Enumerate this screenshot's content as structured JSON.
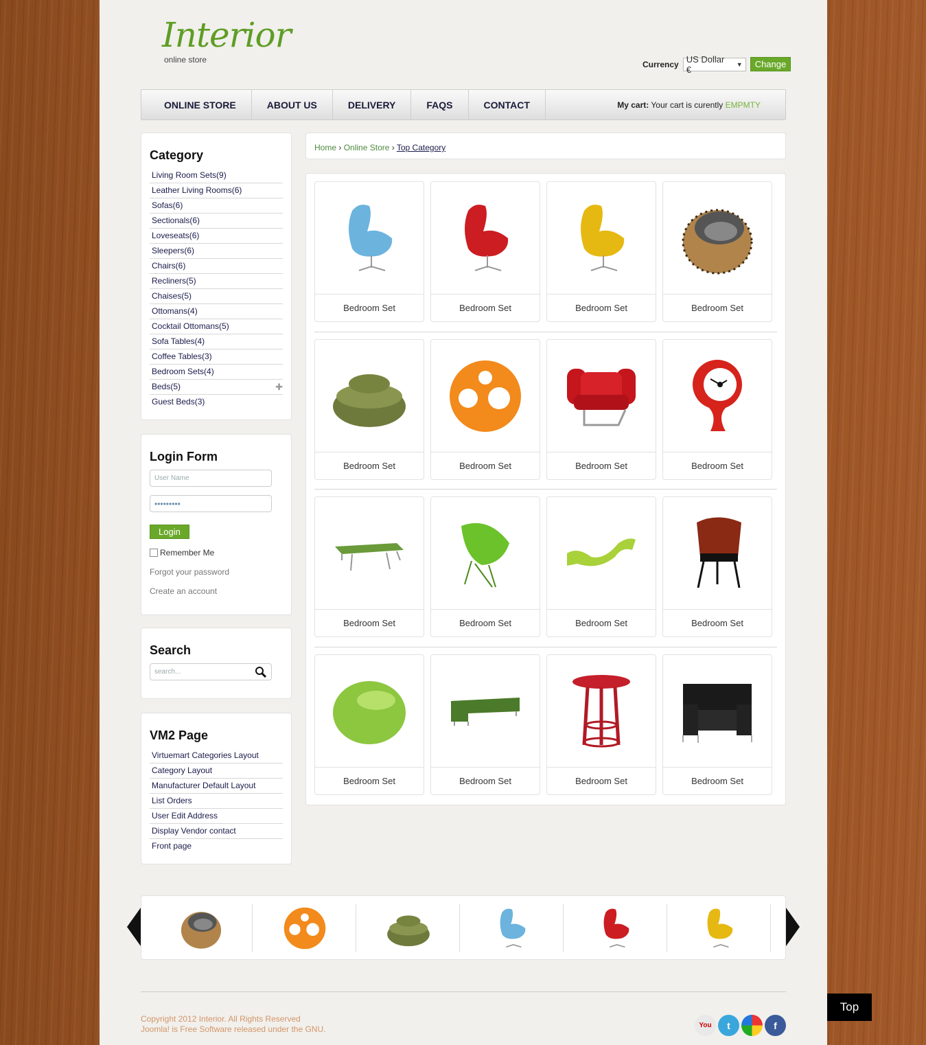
{
  "logo": {
    "title": "Interior",
    "tagline": "online store"
  },
  "currency": {
    "label": "Currency",
    "selected": "US Dollar €",
    "change_label": "Change"
  },
  "nav": {
    "items": [
      "ONLINE STORE",
      "ABOUT US",
      "DELIVERY",
      "FAQS",
      "CONTACT"
    ],
    "cart_label": "My cart:",
    "cart_text": "Your cart is curently",
    "cart_status": "EMPMTY"
  },
  "category": {
    "title": "Category",
    "items": [
      "Living Room Sets(9)",
      "Leather Living Rooms(6)",
      "Sofas(6)",
      "Sectionals(6)",
      "Loveseats(6)",
      "Sleepers(6)",
      "Chairs(6)",
      "Recliners(5)",
      "Chaises(5)",
      "Ottomans(4)",
      "Cocktail Ottomans(5)",
      "Sofa Tables(4)",
      "Coffee Tables(3)",
      "Bedroom Sets(4)",
      "Beds(5)",
      "Guest Beds(3)"
    ]
  },
  "login": {
    "title": "Login Form",
    "username_placeholder": "User Name",
    "password_value": "•••••••••",
    "button": "Login",
    "remember": "Remember Me",
    "forgot": "Forgot your password",
    "create": "Create an account"
  },
  "search": {
    "title": "Search",
    "placeholder": "search..."
  },
  "vm2": {
    "title": "VM2 Page",
    "items": [
      "Virtuemart Categories Layout",
      "Category Layout",
      "Manufacturer Default Layout",
      "List Orders",
      "User Edit Address",
      "Display Vendor contact",
      "Front page"
    ]
  },
  "breadcrumb": {
    "home": "Home",
    "online": "Online Store",
    "current": "Top Category",
    "sep": "›"
  },
  "products": {
    "label": "Bedroom Set"
  },
  "footer": {
    "copyright": "Copyright 2012 Interior. All Rights Reserved",
    "joomla": "Joomla! is Free Software released under the GNU."
  },
  "social": [
    "youtube-icon",
    "twitter-icon",
    "google-icon",
    "facebook-icon"
  ],
  "top": "Top",
  "colors": {
    "accent": "#6aa82a",
    "wood": "#9c5426"
  }
}
